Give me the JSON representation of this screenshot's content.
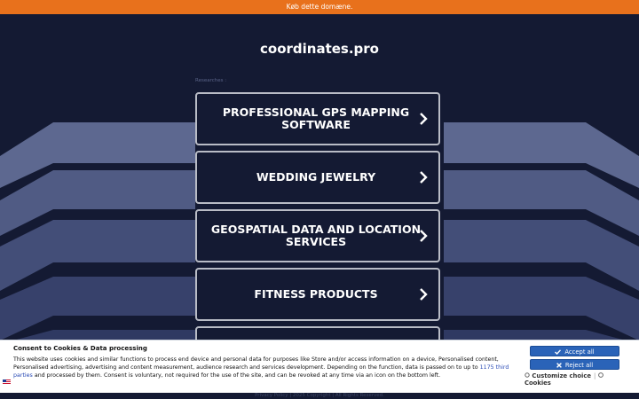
{
  "topbar": {
    "text": "Køb dette domæne."
  },
  "domain": {
    "title": "coordinates.pro"
  },
  "researches_label": "Researches :",
  "links": [
    {
      "label": "PROFESSIONAL GPS MAPPING SOFTWARE"
    },
    {
      "label": "WEDDING JEWELRY"
    },
    {
      "label": "GEOSPATIAL DATA AND LOCATION SERVICES"
    },
    {
      "label": "FITNESS PRODUCTS"
    },
    {
      "label": ""
    }
  ],
  "footer": {
    "privacy": "Privacy Policy",
    "copyright": "2025 Copyright | All Rights Reserved."
  },
  "consent": {
    "title": "Consent to Cookies & Data processing",
    "text_before_link": "This website uses cookies and similar functions to process end device and personal data for purposes like Store and/or access information on a device, Personalised content, Personalised advertising, advertising and content measurement, audience research and services development. Depending on the function, data is passed on to up to ",
    "link_text": "1175 third parties",
    "text_after_link": " and processed by them. Consent is voluntary, not required for the use of the site, and can be revoked at any time via an icon on the bottom left.",
    "accept_label": "Accept all",
    "reject_label": "Reject all",
    "customize_label": "Customize choice",
    "cookies_label": "Cookies"
  },
  "colors": {
    "background": "#141a33",
    "topbar": "#e8711c",
    "button_border": "#b9bcc6",
    "consent_button": "#2a63b8"
  }
}
